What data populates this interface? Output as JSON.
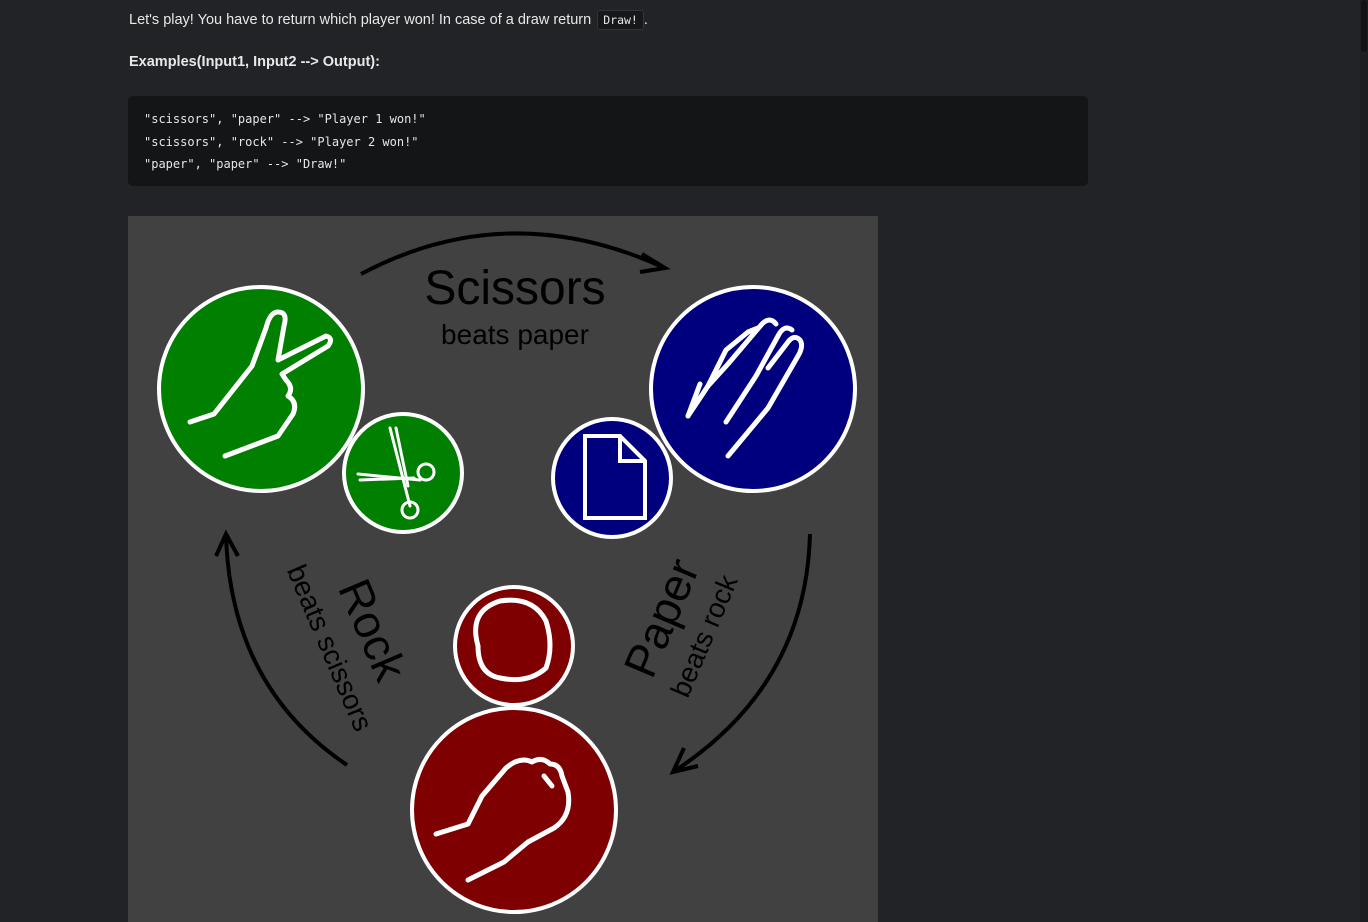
{
  "intro": {
    "text": "Let's play! You have to return which player won! In case of a draw return",
    "code": "Draw!",
    "suffix": "."
  },
  "examples": {
    "heading": "Examples(Input1, Input2 --> Output):",
    "lines": [
      "\"scissors\", \"paper\" --> \"Player 1 won!\"",
      "\"scissors\", \"rock\" --> \"Player 2 won!\"",
      "\"paper\", \"paper\" --> \"Draw!\""
    ]
  },
  "diagram": {
    "scissors_title": "Scissors",
    "scissors_sub": "beats paper",
    "rock_title": "Rock",
    "rock_sub": "beats scissors",
    "paper_title": "Paper",
    "paper_sub": "beats rock",
    "colors": {
      "background": "#414141",
      "scissors": "#007f00",
      "paper": "#00007f",
      "rock": "#7f0000",
      "outline": "#ffffff",
      "arrow": "#000000"
    },
    "icons": [
      "scissors-hand-icon",
      "scissors-icon",
      "paper-hand-icon",
      "paper-sheet-icon",
      "rock-shape-icon",
      "rock-fist-icon"
    ]
  }
}
